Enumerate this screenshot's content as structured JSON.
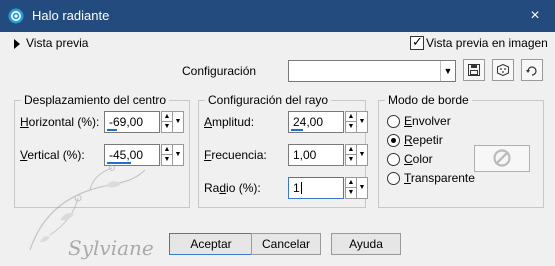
{
  "window": {
    "title": "Halo radiante",
    "close_icon": "×"
  },
  "preview": {
    "toggle_label": "Vista previa",
    "checkbox_label": "Vista previa en imagen",
    "checked": true
  },
  "config": {
    "label": "Configuración",
    "value": ""
  },
  "center_group": {
    "legend": "Desplazamiento del centro",
    "horizontal": {
      "label_pre": "",
      "label_acc": "H",
      "label_post": "orizontal (%):",
      "value": "-69,00"
    },
    "vertical": {
      "label_pre": "",
      "label_acc": "V",
      "label_post": "ertical (%):",
      "value": "-45,00"
    }
  },
  "ray_group": {
    "legend": "Configuración del rayo",
    "amplitud": {
      "label_pre": "",
      "label_acc": "A",
      "label_post": "mplitud:",
      "value": "24,00"
    },
    "frecuencia": {
      "label_pre": "",
      "label_acc": "F",
      "label_post": "recuencia:",
      "value": "1,00"
    },
    "radio": {
      "label_pre": "Ra",
      "label_acc": "d",
      "label_post": "io (%):",
      "value": "1"
    }
  },
  "edge_group": {
    "legend": "Modo de borde",
    "options": [
      {
        "pre": "",
        "acc": "E",
        "post": "nvolver",
        "selected": false
      },
      {
        "pre": "",
        "acc": "R",
        "post": "epetir",
        "selected": true
      },
      {
        "pre": "",
        "acc": "C",
        "post": "olor",
        "selected": false
      },
      {
        "pre": "",
        "acc": "T",
        "post": "ransparente",
        "selected": false
      }
    ]
  },
  "buttons": {
    "ok": "Aceptar",
    "cancel": "Cancelar",
    "help": "Ayuda"
  },
  "watermark_text": "Sylviane"
}
